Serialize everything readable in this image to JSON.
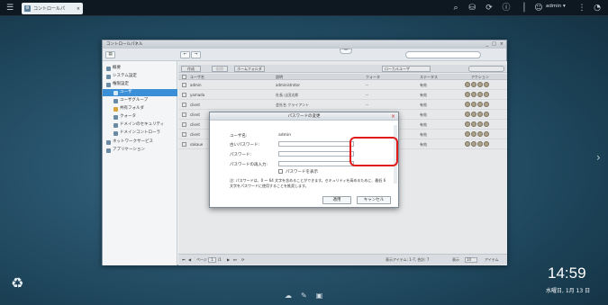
{
  "topbar": {
    "menu_icon": "hamburger-icon",
    "app_tab_label": "コントロールパ",
    "app_tab_close": "×",
    "user_label": "admin ▾"
  },
  "window": {
    "title": "コントロールパネル",
    "controls": [
      "_",
      "□",
      "×"
    ]
  },
  "sidebar": {
    "items": [
      {
        "label": "概要",
        "selected": false
      },
      {
        "label": "システム設定",
        "selected": false
      },
      {
        "label": "権限設定",
        "selected": false
      },
      {
        "label": "ユーザ",
        "selected": true
      },
      {
        "label": "ユーザグループ",
        "selected": false
      },
      {
        "label": "共有フォルダ",
        "selected": false
      },
      {
        "label": "クォータ",
        "selected": false
      },
      {
        "label": "ドメインのセキュリティ",
        "selected": false
      },
      {
        "label": "ドメインコントローラ",
        "selected": false
      },
      {
        "label": "ネットワークサービス",
        "selected": false
      },
      {
        "label": "アプリケーション",
        "selected": false
      }
    ]
  },
  "grid": {
    "create_label": "作成",
    "delete_label": "削除",
    "home_folder_label": "ホームフォルダ",
    "scope_select": "ローカルユーザ",
    "columns": [
      "ユーザ名",
      "説明",
      "クォータ",
      "ステータス",
      "アクション"
    ],
    "rows": [
      {
        "name": "admin",
        "desc": "administrator",
        "quota": "--",
        "status": "有効"
      },
      {
        "name": "yamada",
        "desc": "社長 山田太郎",
        "quota": "--",
        "status": "有効"
      },
      {
        "name": "client",
        "desc": "会社名 クライアント",
        "quota": "--",
        "status": "有効"
      },
      {
        "name": "client",
        "desc": "",
        "quota": "",
        "status": "有効"
      },
      {
        "name": "client",
        "desc": "",
        "quota": "",
        "status": "有効"
      },
      {
        "name": "client",
        "desc": "",
        "quota": "",
        "status": "有効"
      },
      {
        "name": "sakaue",
        "desc": "",
        "quota": "",
        "status": "有効"
      }
    ],
    "pager": {
      "page_label": "ページ",
      "page_value": "1",
      "of_label": "/1",
      "range_text": "表示アイテム: 1-7, 合計: 7",
      "per_page_label": "表示",
      "per_page_value": "10",
      "items_label": "アイテム"
    }
  },
  "dialog": {
    "title": "パスワードの変更",
    "username_label": "ユーザ名:",
    "username_value": "admin",
    "old_pw_label": "古いパスワード:",
    "new_pw_label": "パスワード:",
    "confirm_pw_label": "パスワードの再入力:",
    "show_pw_label": "パスワードを表示",
    "note": "注: パスワードは、0 ～ 64 文字を含めることができます。セキュリティを高めるために、最低 6 文字をパスワードに使用することを推奨します。",
    "apply_label": "適用",
    "cancel_label": "キャンセル",
    "close_glyph": "×"
  },
  "clock": {
    "time": "14:59",
    "date": "水曜日, 1月 13 日"
  },
  "colors": {
    "accent": "#3a8fd6",
    "highlight": "#e11a1a"
  }
}
